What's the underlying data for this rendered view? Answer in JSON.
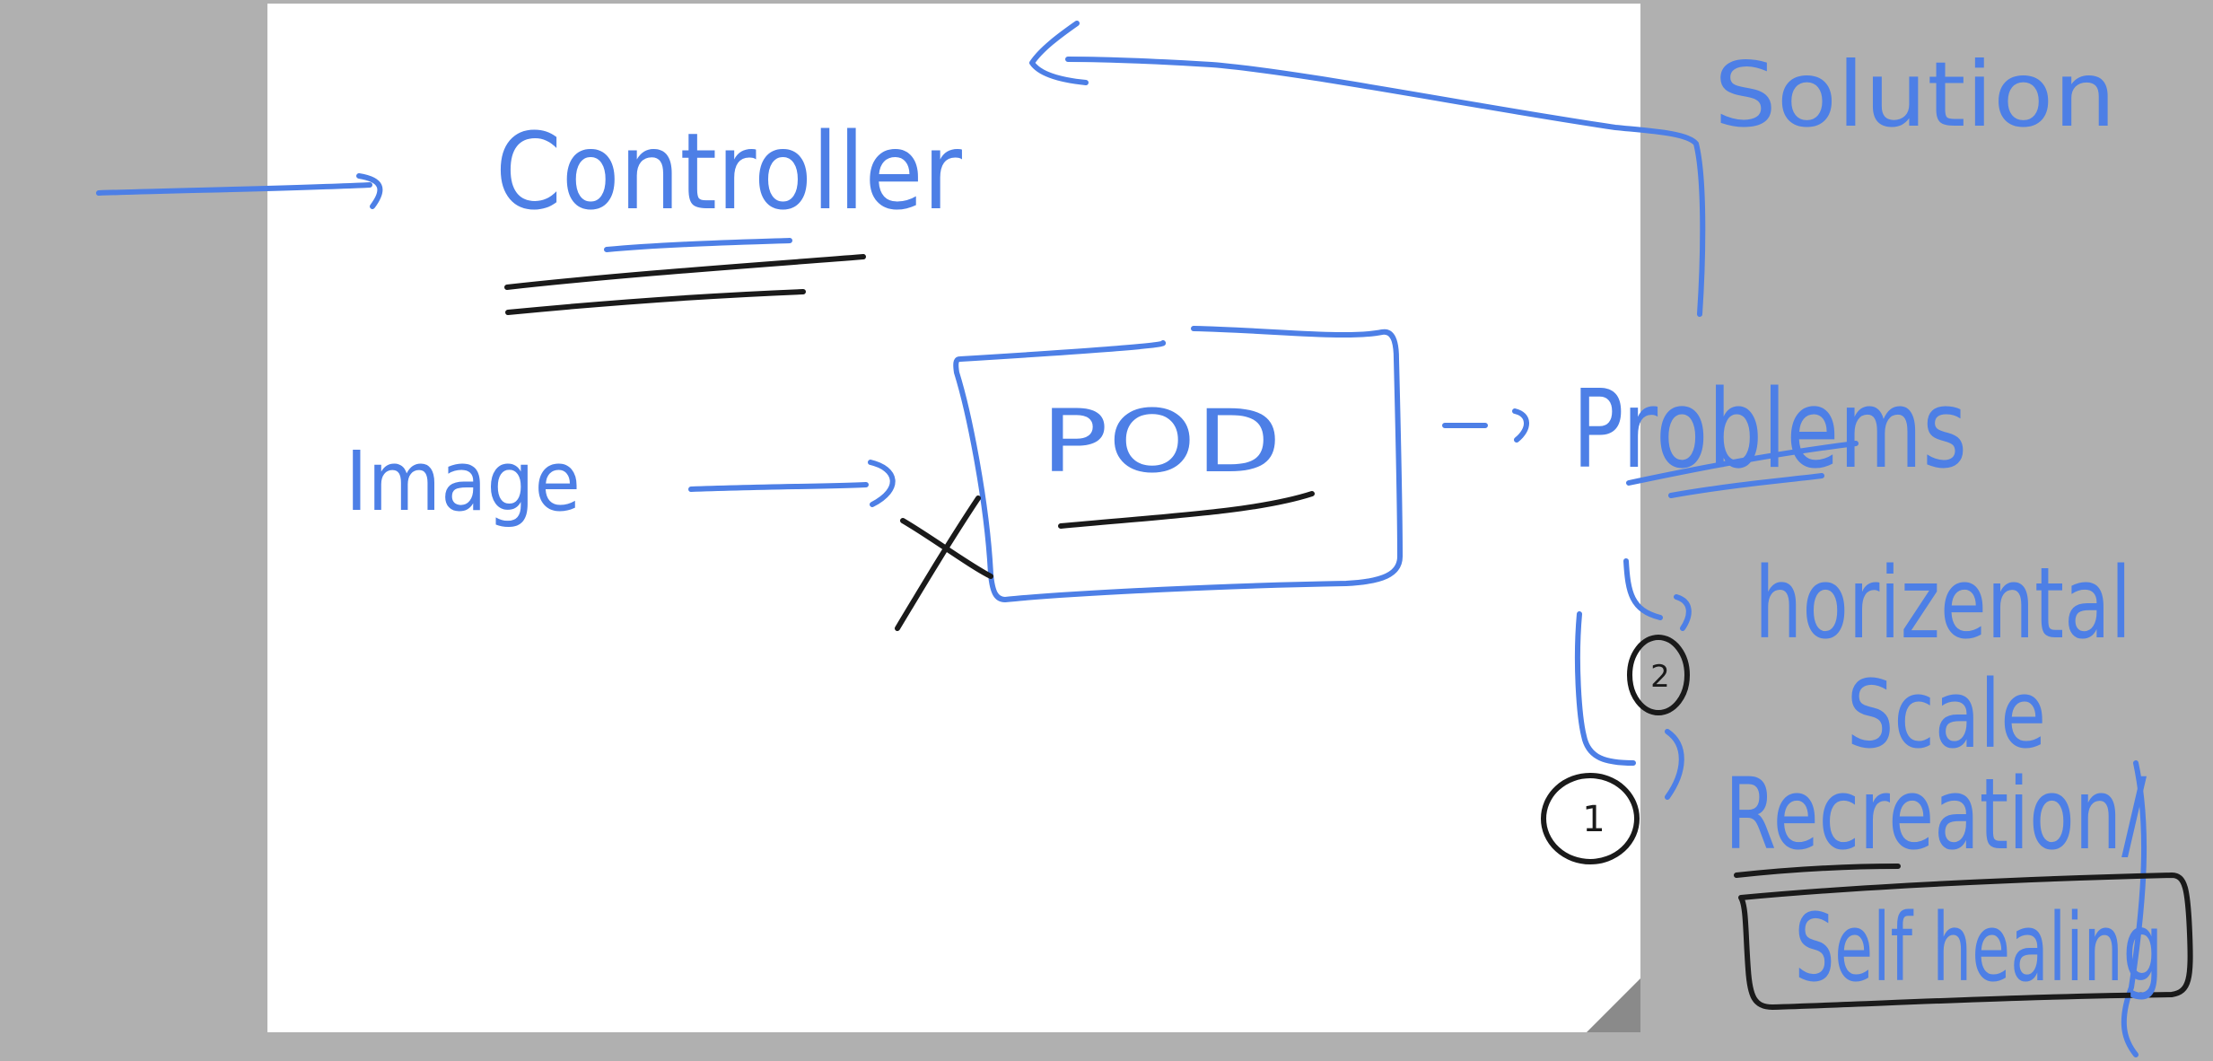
{
  "colors": {
    "workspace_bg": "#b0b0b0",
    "page_bg": "#ffffff",
    "ink_blue": "#4d7fe6",
    "ink_black": "#1a1a1a",
    "resize_corner": "#8a8a8a"
  },
  "board": {
    "labels": {
      "controller": "Controller",
      "image": "Image",
      "pod": "POD",
      "problems": "Problems",
      "solution": "Solution",
      "horizontal": "horizental",
      "scale": "Scale",
      "recreation": "Recreation/",
      "self_healing": "Self healing"
    },
    "markers": {
      "one": "1",
      "two": "2"
    }
  }
}
